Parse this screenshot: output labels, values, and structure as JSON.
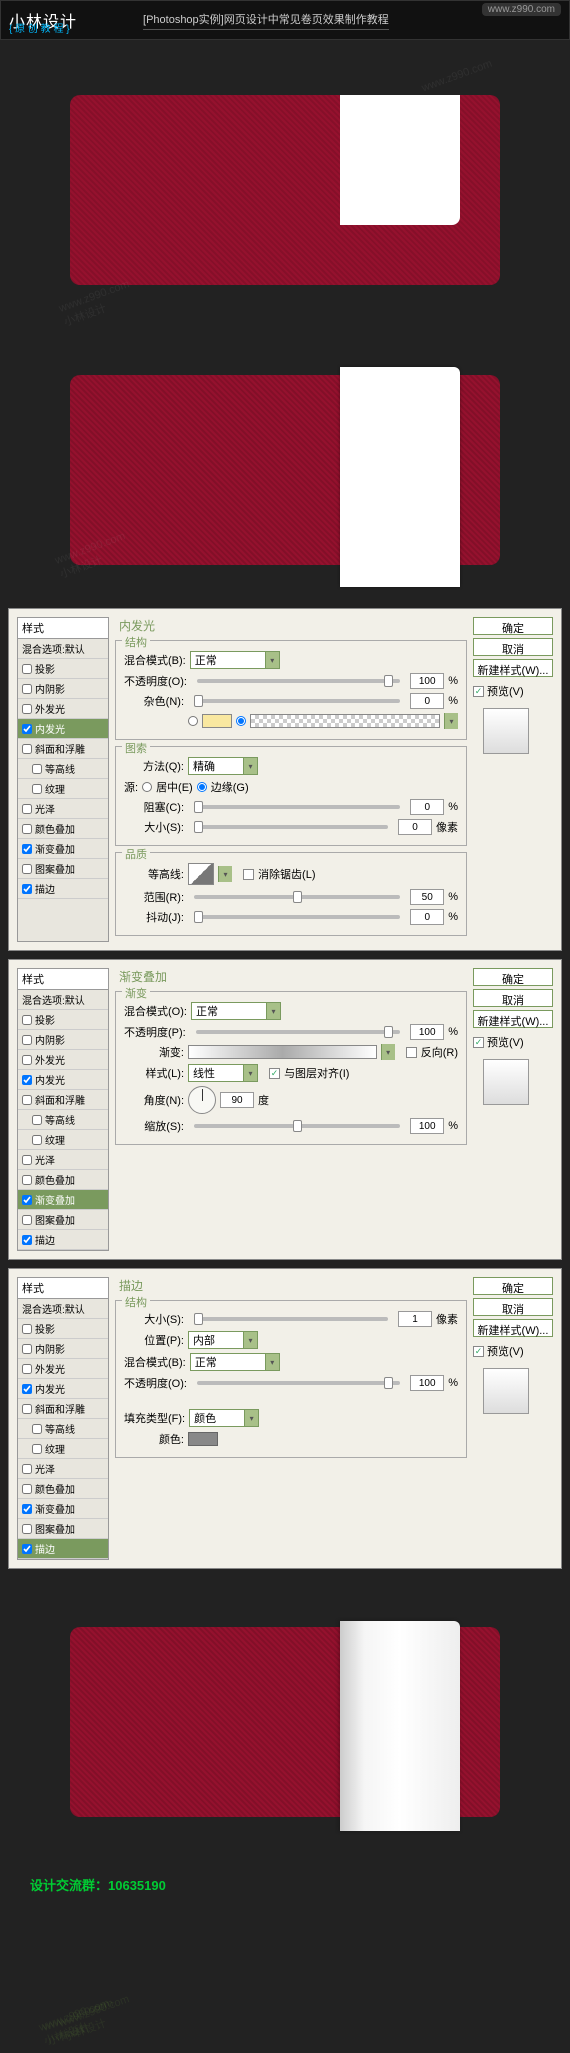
{
  "header": {
    "logo": "小林设计",
    "subtitle": "{ 原 创 教 程 }",
    "title": "[Photoshop实例]网页设计中常见卷页效果制作教程",
    "url": "www.z990.com"
  },
  "watermarks": {
    "url": "www.z990.com",
    "brand": "小林设计"
  },
  "styles_header": "样式",
  "blend_default": "混合选项:默认",
  "style_items": {
    "drop_shadow": "投影",
    "inner_shadow": "内阴影",
    "outer_glow": "外发光",
    "inner_glow": "内发光",
    "bevel": "斜面和浮雕",
    "contour": "等高线",
    "texture": "纹理",
    "gloss": "光泽",
    "color_overlay": "颜色叠加",
    "grad_overlay": "渐变叠加",
    "pattern_overlay": "图案叠加",
    "stroke": "描边"
  },
  "buttons": {
    "ok": "确定",
    "cancel": "取消",
    "new_style": "新建样式(W)...",
    "preview": "预览(V)"
  },
  "panel1": {
    "title": "内发光",
    "sections": {
      "structure": "结构",
      "elements": "图索",
      "quality": "品质"
    },
    "labels": {
      "blend_mode": "混合模式(B):",
      "opacity": "不透明度(O):",
      "noise": "杂色(N):",
      "method": "方法(Q):",
      "source": "源:",
      "center": "居中(E)",
      "edge": "边缘(G)",
      "choke": "阻塞(C):",
      "size": "大小(S):",
      "contour": "等高线:",
      "anti_alias": "消除锯齿(L)",
      "range": "范围(R):",
      "jitter": "抖动(J):"
    },
    "values": {
      "blend": "正常",
      "opacity": "100",
      "noise": "0",
      "method": "精确",
      "choke": "0",
      "size": "0",
      "range": "50",
      "jitter": "0"
    },
    "units": {
      "percent": "%",
      "px": "像素"
    }
  },
  "panel2": {
    "title": "渐变叠加",
    "section": "渐变",
    "labels": {
      "blend_mode": "混合模式(O):",
      "opacity": "不透明度(P):",
      "gradient": "渐变:",
      "reverse": "反向(R)",
      "style": "样式(L):",
      "align": "与图层对齐(I)",
      "angle": "角度(N):",
      "scale": "缩放(S):"
    },
    "values": {
      "blend": "正常",
      "opacity": "100",
      "style": "线性",
      "angle": "90",
      "scale": "100"
    },
    "units": {
      "percent": "%",
      "deg": "度"
    }
  },
  "panel3": {
    "title": "描边",
    "section": "结构",
    "labels": {
      "size": "大小(S):",
      "position": "位置(P):",
      "blend_mode": "混合模式(B):",
      "opacity": "不透明度(O):",
      "fill_type": "填充类型(F):",
      "color": "颜色:"
    },
    "values": {
      "size": "1",
      "position": "内部",
      "blend": "正常",
      "opacity": "100",
      "fill_type": "颜色"
    },
    "units": {
      "percent": "%",
      "px": "像素"
    }
  },
  "footer": {
    "label": "设计交流群：",
    "number": "10635190"
  }
}
